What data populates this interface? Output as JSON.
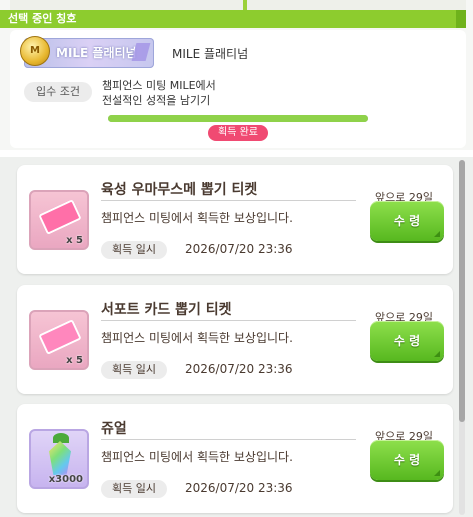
{
  "title_panel": {
    "header": "선택 중인 칭호",
    "badge_text": "MILE 플래티넘",
    "badge_medal": "M",
    "title_name": "MILE 플래티넘",
    "condition_label": "입수 조건",
    "condition_line1": "챔피언스 미팅 MILE에서",
    "condition_line2": "전설적인 성적을 남기기",
    "progress": 1.0,
    "complete_label": "획득 완료"
  },
  "items": [
    {
      "title": "육성 우마무스메 뽑기 티켓",
      "description": "챔피언스 미팅에서 획득한 보상입니다.",
      "quantity": "x 5",
      "date_label": "획득 일시",
      "date": "2026/07/20 23:36",
      "remaining": "앞으로 29일",
      "claim_label": "수 령",
      "icon": "ticket-icon"
    },
    {
      "title": "서포트 카드 뽑기 티켓",
      "description": "챔피언스 미팅에서 획득한 보상입니다.",
      "quantity": "x 5",
      "date_label": "획득 일시",
      "date": "2026/07/20 23:36",
      "remaining": "앞으로 29일",
      "claim_label": "수 령",
      "icon": "support-ticket-icon"
    },
    {
      "title": "쥬얼",
      "description": "챔피언스 미팅에서 획득한 보상입니다.",
      "quantity": "x3000",
      "date_label": "획득 일시",
      "date": "2026/07/20 23:36",
      "remaining": "앞으로 29일",
      "claim_label": "수 령",
      "icon": "jewel-icon"
    }
  ],
  "colors": {
    "accent_green": "#8dcc2e",
    "claim_button": "#6cc92f",
    "complete_badge": "#f04a72"
  }
}
